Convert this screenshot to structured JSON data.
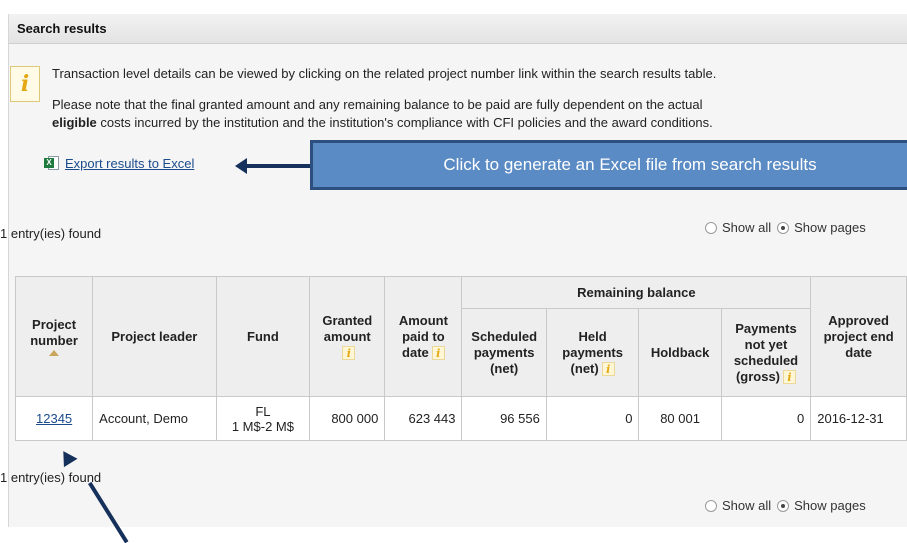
{
  "panel": {
    "title": "Search results"
  },
  "info": {
    "icon": "info-icon",
    "line1": "Transaction level details can be viewed by clicking on the related project number link within the search results table.",
    "line2": "Please note that the final granted amount and any remaining balance to be paid are fully dependent on the actual",
    "line3_bold": "eligible",
    "line3_rest": " costs incurred by the institution and the institution's compliance with CFI policies and the award conditions."
  },
  "export": {
    "label": "Export results to Excel",
    "icon": "excel-icon"
  },
  "callout": {
    "text": "Click to generate an Excel file from search results"
  },
  "entries_text": "1 entry(ies) found",
  "pager": {
    "show_all": "Show all",
    "show_pages": "Show pages",
    "selected": "Show pages"
  },
  "table": {
    "group_header": "Remaining balance",
    "headers": {
      "project_number": "Project number",
      "project_leader": "Project leader",
      "fund": "Fund",
      "granted_amount": "Granted amount",
      "amount_paid": "Amount paid to date",
      "scheduled_payments": "Scheduled payments (net)",
      "held_payments": "Held payments (net)",
      "holdback": "Holdback",
      "not_scheduled": "Payments not yet scheduled (gross)",
      "end_date": "Approved project end date"
    },
    "row": {
      "project_number": "12345",
      "project_leader": "Account, Demo",
      "fund_line1": "FL",
      "fund_line2": "1 M$-2 M$",
      "granted_amount": "800 000",
      "amount_paid": "623 443",
      "scheduled_payments": "96 556",
      "held_payments": "0",
      "holdback": "80 001",
      "not_scheduled": "0",
      "end_date": "2016-12-31"
    }
  },
  "colors": {
    "link": "#1a4b8c",
    "callout_bg": "#5b8bc4",
    "arrow": "#15305a"
  }
}
